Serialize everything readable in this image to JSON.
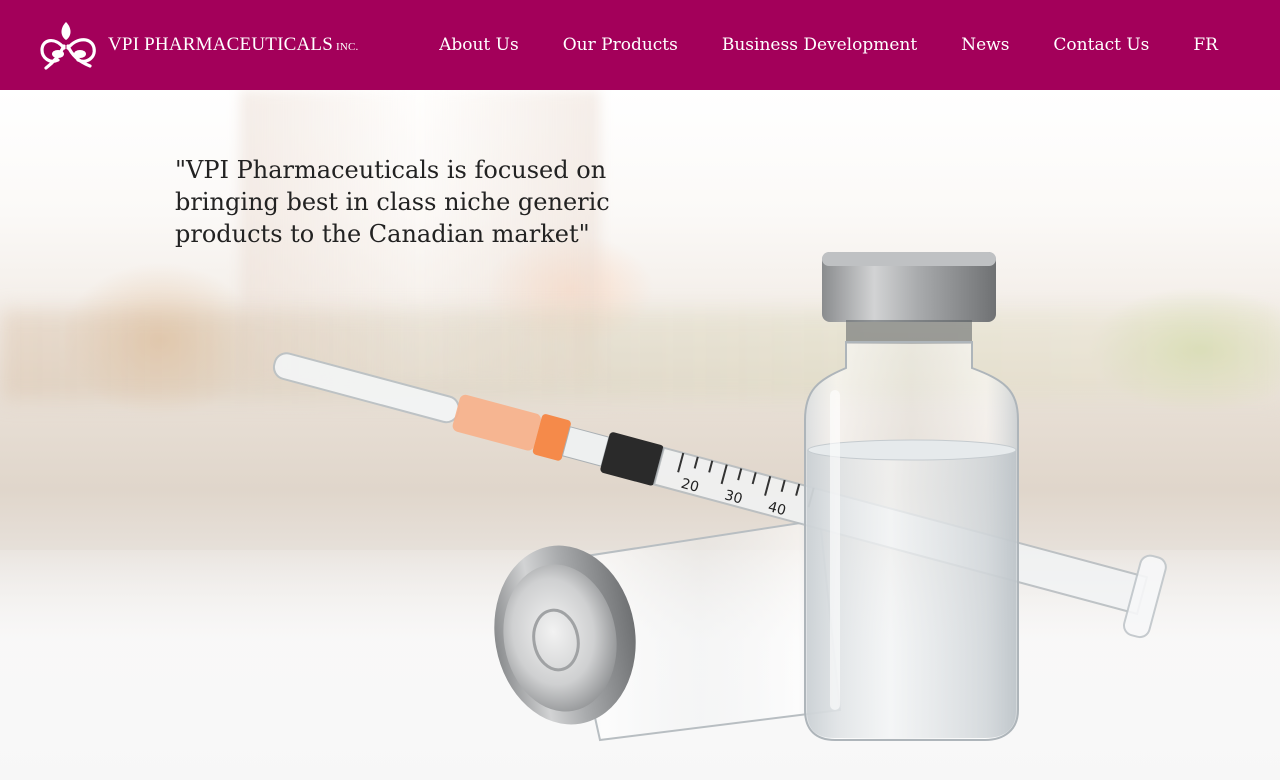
{
  "header": {
    "brand": "VPI PHARMACEUTICALS",
    "brand_suffix": "INC.",
    "background_color": "#a3005a"
  },
  "nav": {
    "items": [
      {
        "label": "About Us"
      },
      {
        "label": "Our Products"
      },
      {
        "label": "Business Development"
      },
      {
        "label": "News"
      },
      {
        "label": "Contact Us"
      },
      {
        "label": "FR"
      }
    ]
  },
  "hero": {
    "quote": "\"VPI Pharmaceuticals is focused on bringing best in class niche generic products to the Canadian market\"",
    "syringe_scale": [
      "20",
      "30",
      "40"
    ],
    "image_icon": "syringe-and-vials-photo"
  }
}
